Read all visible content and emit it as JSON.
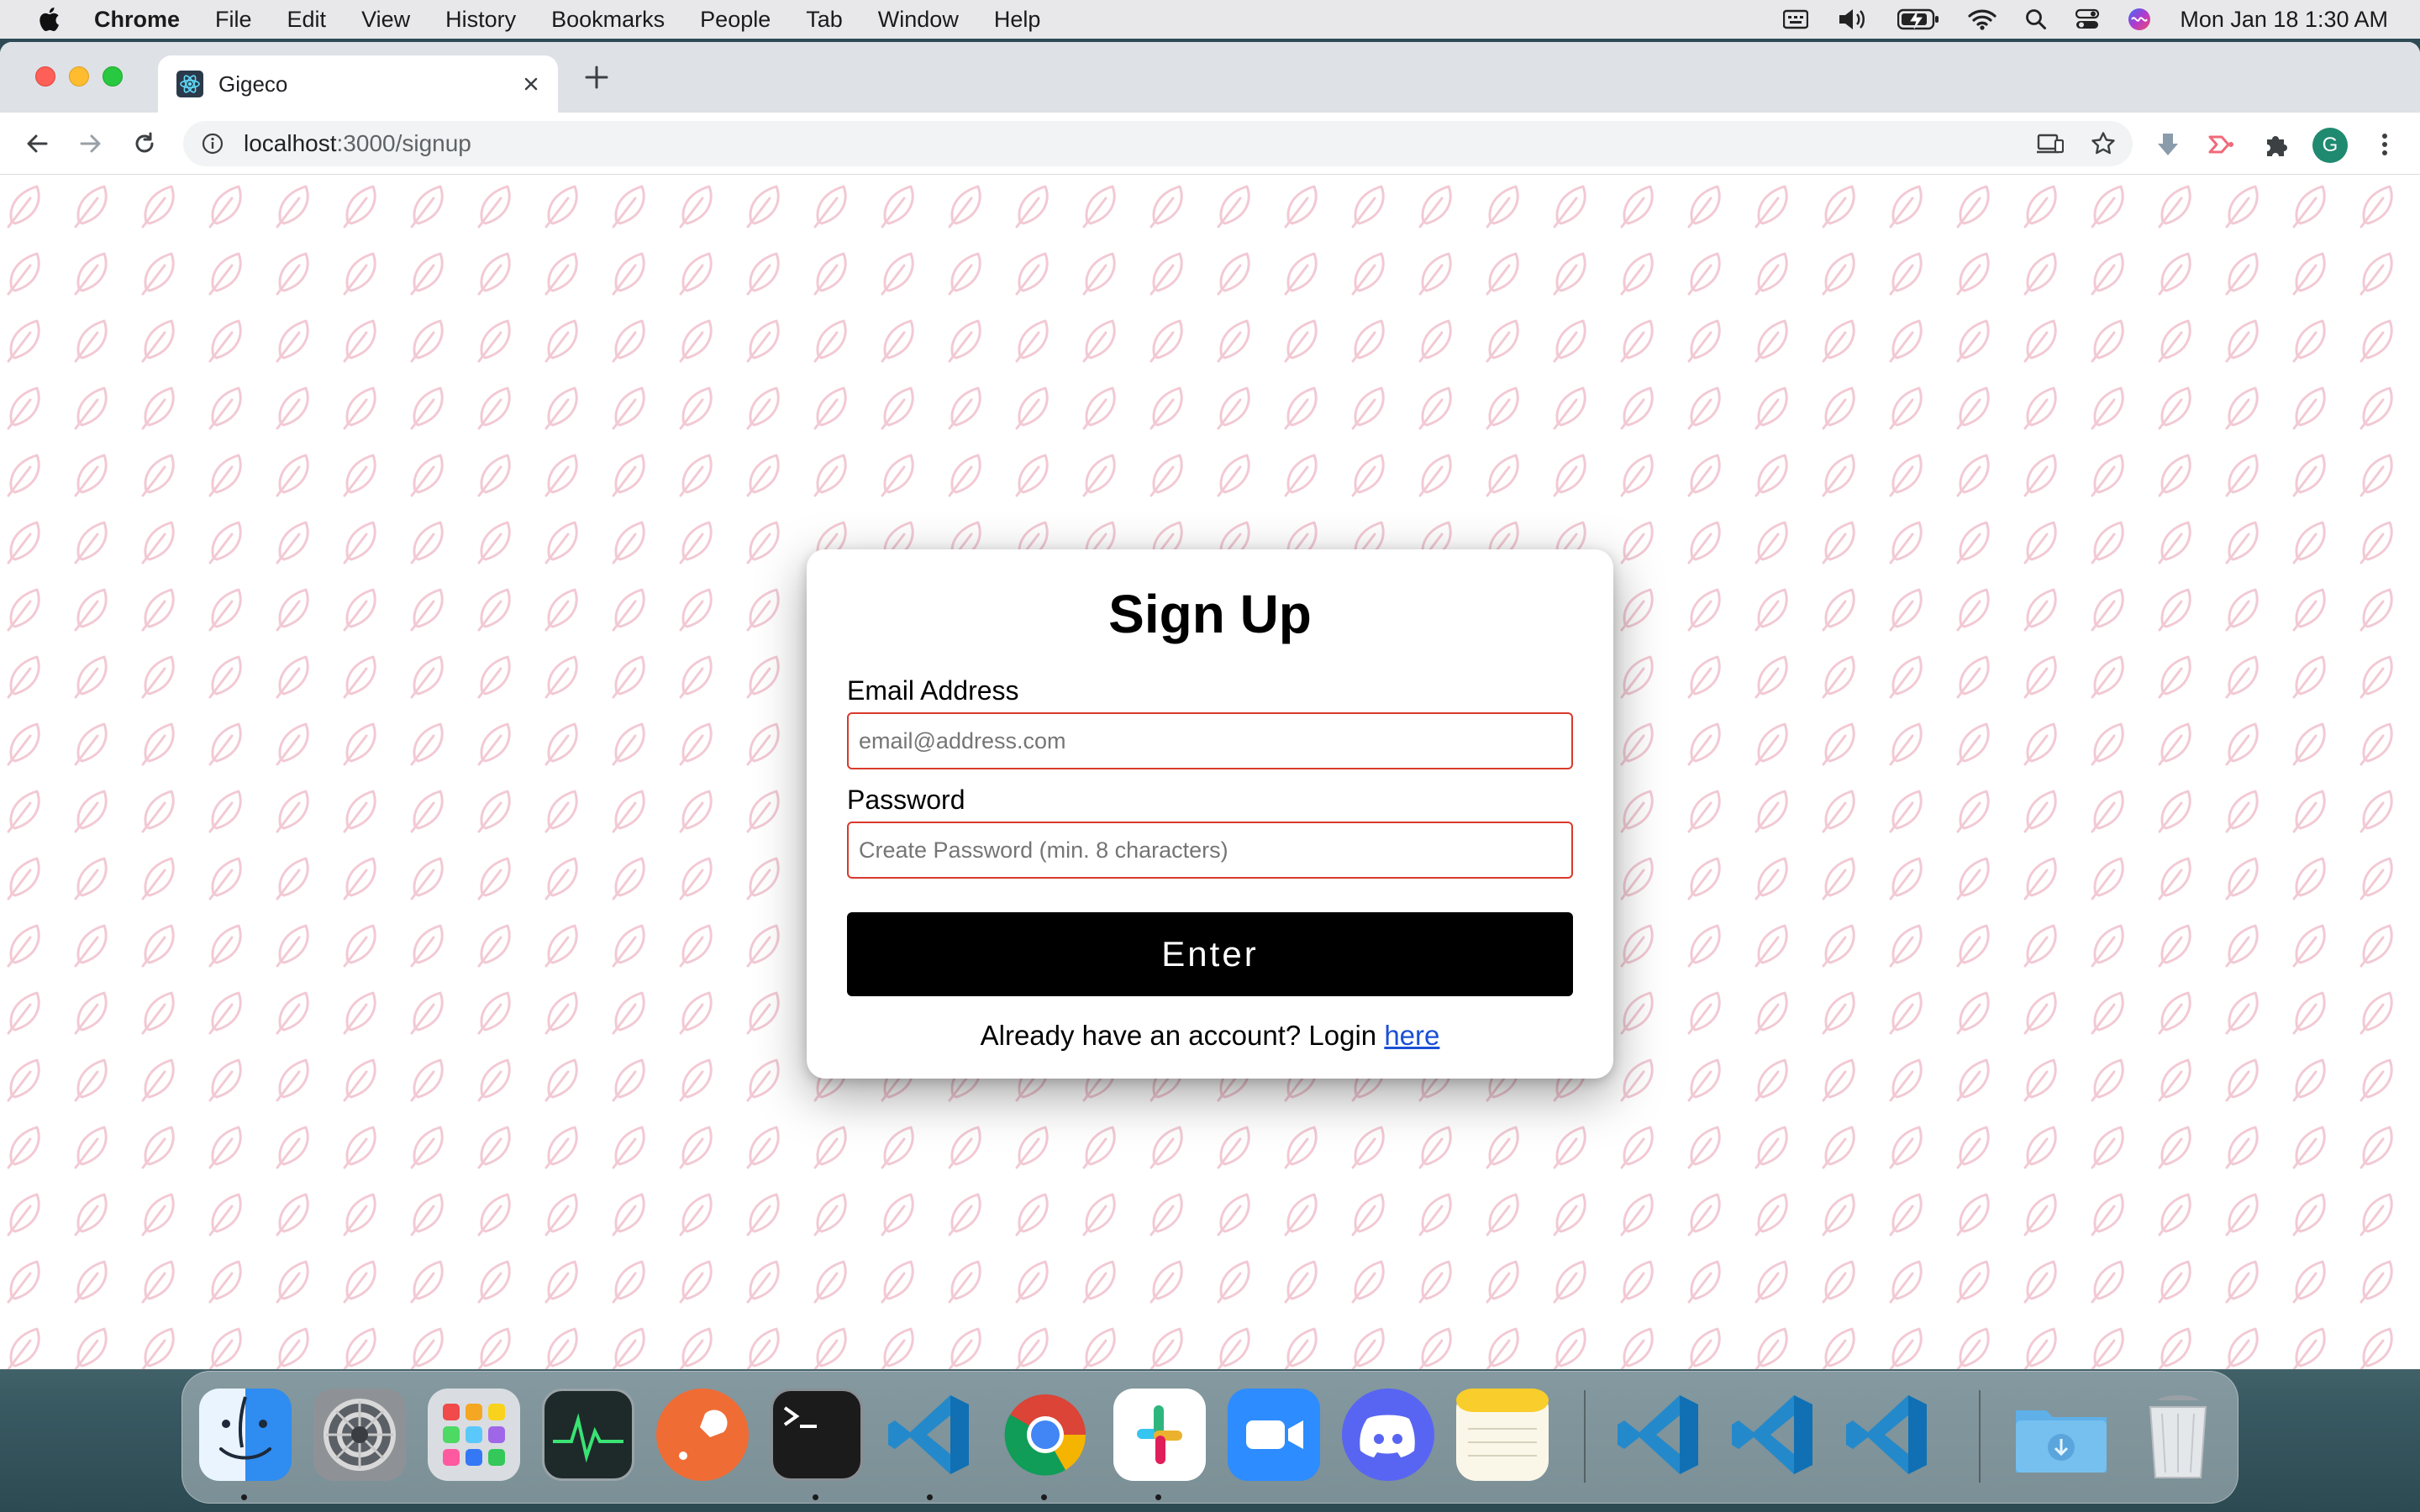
{
  "menubar": {
    "app_name": "Chrome",
    "items": [
      "File",
      "Edit",
      "View",
      "History",
      "Bookmarks",
      "People",
      "Tab",
      "Window",
      "Help"
    ],
    "clock": "Mon Jan 18  1:30 AM",
    "status_icons": [
      "keyboard-input-icon",
      "volume-icon",
      "battery-charging-icon",
      "wifi-icon",
      "spotlight-search-icon",
      "control-center-icon",
      "siri-icon"
    ]
  },
  "browser": {
    "tab_title": "Gigeco",
    "url_host": "localhost",
    "url_path": ":3000/signup",
    "profile_initial": "G"
  },
  "signup": {
    "heading": "Sign Up",
    "email_label": "Email Address",
    "email_placeholder": "email@address.com",
    "email_value": "",
    "password_label": "Password",
    "password_placeholder": "Create Password (min. 8 characters)",
    "password_value": "",
    "submit_label": "Enter",
    "login_prompt": "Already have an account? Login",
    "login_link": "here"
  },
  "colors": {
    "input_border": "#d93a2b",
    "button_bg": "#000000",
    "link": "#1a4fd6",
    "pattern": "#f2c9d4"
  },
  "dock": {
    "apps": [
      "finder-icon",
      "system-preferences-icon",
      "launchpad-icon",
      "activity-monitor-icon",
      "postman-icon",
      "terminal-icon",
      "vscode-icon",
      "chrome-icon",
      "slack-icon",
      "zoom-icon",
      "discord-icon",
      "notes-icon",
      "vscode-icon",
      "vscode-icon",
      "vscode-icon",
      "downloads-folder-icon",
      "trash-icon"
    ]
  }
}
